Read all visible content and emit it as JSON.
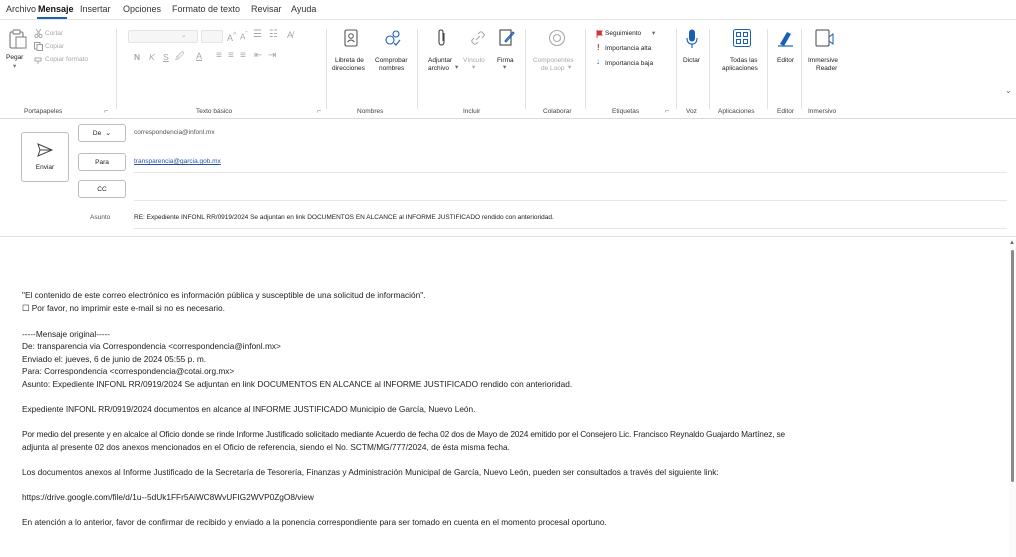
{
  "menu": {
    "items": [
      "Archivo",
      "Mensaje",
      "Insertar",
      "Opciones",
      "Formato de texto",
      "Revisar",
      "Ayuda"
    ],
    "active": "Mensaje"
  },
  "ribbon": {
    "clipboard": {
      "paste": "Pegar",
      "cut": "Cortar",
      "copy": "Copiar",
      "format_painter": "Copiar formato",
      "group": "Portapapeles"
    },
    "basic_text": {
      "bold": "N",
      "italic": "K",
      "underline": "S",
      "group": "Texto básico"
    },
    "names": {
      "address_book_l1": "Libreta de",
      "address_book_l2": "direcciones",
      "check_names_l1": "Comprobar",
      "check_names_l2": "nombres",
      "group": "Nombres"
    },
    "include": {
      "attach_l1": "Adjuntar",
      "attach_l2": "archivo",
      "link": "Vínculo",
      "signature": "Firma",
      "group": "Incluir"
    },
    "collaborate": {
      "loop_l1": "Componentes",
      "loop_l2": "de Loop",
      "group": "Colaborar"
    },
    "tags": {
      "followup": "Seguimiento",
      "high": "Importancia alta",
      "low": "Importancia baja",
      "group": "Etiquetas"
    },
    "voice": {
      "dictate": "Dictar",
      "group": "Voz"
    },
    "apps": {
      "all_l1": "Todas las",
      "all_l2": "aplicaciones",
      "group": "Aplicaciones"
    },
    "editor": {
      "editor": "Editor",
      "group": "Editor"
    },
    "immersive": {
      "reader_l1": "Immersive",
      "reader_l2": "Reader",
      "group": "Inmersivo"
    }
  },
  "compose": {
    "send": "Enviar",
    "from_label": "De",
    "from_value": "correspondencia@infonl.mx",
    "to_label": "Para",
    "to_value": "transparencia@garcia.gob.mx",
    "cc_label": "CC",
    "cc_value": "",
    "subject_label": "Asunto",
    "subject_value": "RE: Expediente INFONL RR/0919/2024 Se adjuntan en link DOCUMENTOS EN ALCANCE al INFORME JUSTIFICADO rendido con anterioridad."
  },
  "body": {
    "disclaimer": "\"El contenido de este correo electrónico es información pública y susceptible de una solicitud de información\".",
    "print_note": "☐ Por favor, no imprimir este e-mail si no es necesario.",
    "original_header": "-----Mensaje original-----",
    "orig_from": "De: transparencia via Correspondencia <correspondencia@infonl.mx>",
    "orig_sent": "Enviado el: jueves, 6 de junio de 2024 05:55 p. m.",
    "orig_to": "Para: Correspondencia <correspondencia@cotai.org.mx>",
    "orig_subject": "Asunto: Expediente INFONL RR/0919/2024 Se adjuntan en link DOCUMENTOS EN ALCANCE al INFORME JUSTIFICADO rendido con anterioridad.",
    "p1": "Expediente INFONL RR/0919/2024 documentos en alcance al INFORME JUSTIFICADO Municipio de García, Nuevo León.",
    "p2_l1": "Por medio del presente y en alcalce al Oficio donde se rinde Informe Justificado solicitado mediante Acuerdo de fecha 02 dos de Mayo de 2024 emitido por el Consejero Lic. Francisco Reynaldo Guajardo Martínez, se",
    "p2_l2": "adjunta al presente 02 dos anexos mencionados en el Oficio de referencia, siendo el No. SCTM/MG/777/2024, de ésta misma fecha.",
    "p3": "Los documentos anexos al Informe Justificado de la Secretaría de Tesorería, Finanzas y Administración Municipal de García, Nuevo León, pueden ser consultados a través del siguiente link:",
    "link": "https://drive.google.com/file/d/1u--5dUk1FFr5AiWC8WvUFIG2WVP0ZgO8/view",
    "p4": "En atención a lo anterior, favor de confirmar de recibido y enviado a la ponencia correspondiente para ser tomado en cuenta en el momento procesal oportuno."
  },
  "colors": {
    "accent": "#1a5fb4",
    "flag_red": "#d13438",
    "link": "#2451a6"
  }
}
